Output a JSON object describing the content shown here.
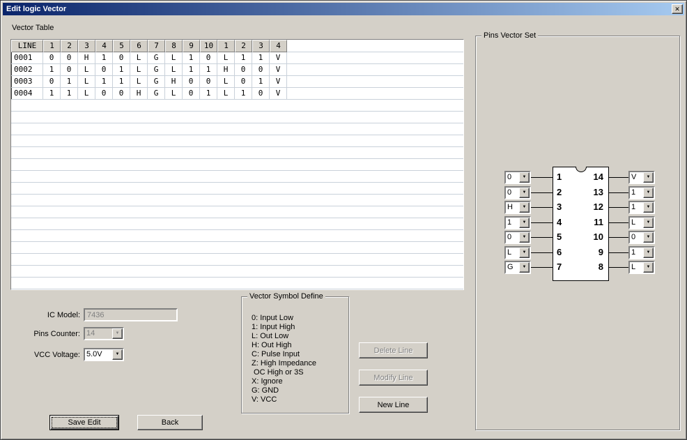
{
  "window": {
    "title": "Edit logic Vector",
    "close_glyph": "✕"
  },
  "icons": {
    "dropdown_arrow": "▼"
  },
  "vector_table": {
    "label": "Vector Table",
    "headers": [
      "LINE",
      "1",
      "2",
      "3",
      "4",
      "5",
      "6",
      "7",
      "8",
      "9",
      "10",
      "1",
      "2",
      "3",
      "4"
    ],
    "rows": [
      [
        "0001",
        "0",
        "0",
        "H",
        "1",
        "0",
        "L",
        "G",
        "L",
        "1",
        "0",
        "L",
        "1",
        "1",
        "V"
      ],
      [
        "0002",
        "1",
        "0",
        "L",
        "0",
        "1",
        "L",
        "G",
        "L",
        "1",
        "1",
        "H",
        "0",
        "0",
        "V"
      ],
      [
        "0003",
        "0",
        "1",
        "L",
        "1",
        "1",
        "L",
        "G",
        "H",
        "0",
        "0",
        "L",
        "0",
        "1",
        "V"
      ],
      [
        "0004",
        "1",
        "1",
        "L",
        "0",
        "0",
        "H",
        "G",
        "L",
        "0",
        "1",
        "L",
        "1",
        "0",
        "V"
      ]
    ]
  },
  "ic_form": {
    "ic_model_label": "IC Model:",
    "ic_model_value": "7436",
    "pins_counter_label": "Pins Counter:",
    "pins_counter_value": "14",
    "vcc_label": "VCC Voltage:",
    "vcc_value": "5.0V"
  },
  "symbol_define": {
    "label": "Vector Symbol Define",
    "lines": [
      "0: Input Low",
      "1: Input High",
      "L: Out Low",
      "H: Out High",
      "C: Pulse Input",
      "Z: High Impedance",
      " OC High or 3S",
      "X: Ignore",
      "G: GND",
      "V: VCC"
    ]
  },
  "actions": {
    "delete_line": "Delete Line",
    "modify_line": "Modify Line",
    "new_line": "New Line",
    "save_edit": "Save Edit",
    "back": "Back"
  },
  "pins_vector_set": {
    "label": "Pins Vector Set",
    "left_pins": [
      {
        "pin": "1",
        "value": "0"
      },
      {
        "pin": "2",
        "value": "0"
      },
      {
        "pin": "3",
        "value": "H"
      },
      {
        "pin": "4",
        "value": "1"
      },
      {
        "pin": "5",
        "value": "0"
      },
      {
        "pin": "6",
        "value": "L"
      },
      {
        "pin": "7",
        "value": "G"
      }
    ],
    "right_pins": [
      {
        "pin": "14",
        "value": "V"
      },
      {
        "pin": "13",
        "value": "1"
      },
      {
        "pin": "12",
        "value": "1"
      },
      {
        "pin": "11",
        "value": "L"
      },
      {
        "pin": "10",
        "value": "0"
      },
      {
        "pin": "9",
        "value": "1"
      },
      {
        "pin": "8",
        "value": "L"
      }
    ]
  },
  "colors": {
    "face": "#d4d0c8",
    "title_gradient_start": "#0a246a",
    "title_gradient_end": "#a6caf0",
    "grid_line": "#c9d1da"
  }
}
